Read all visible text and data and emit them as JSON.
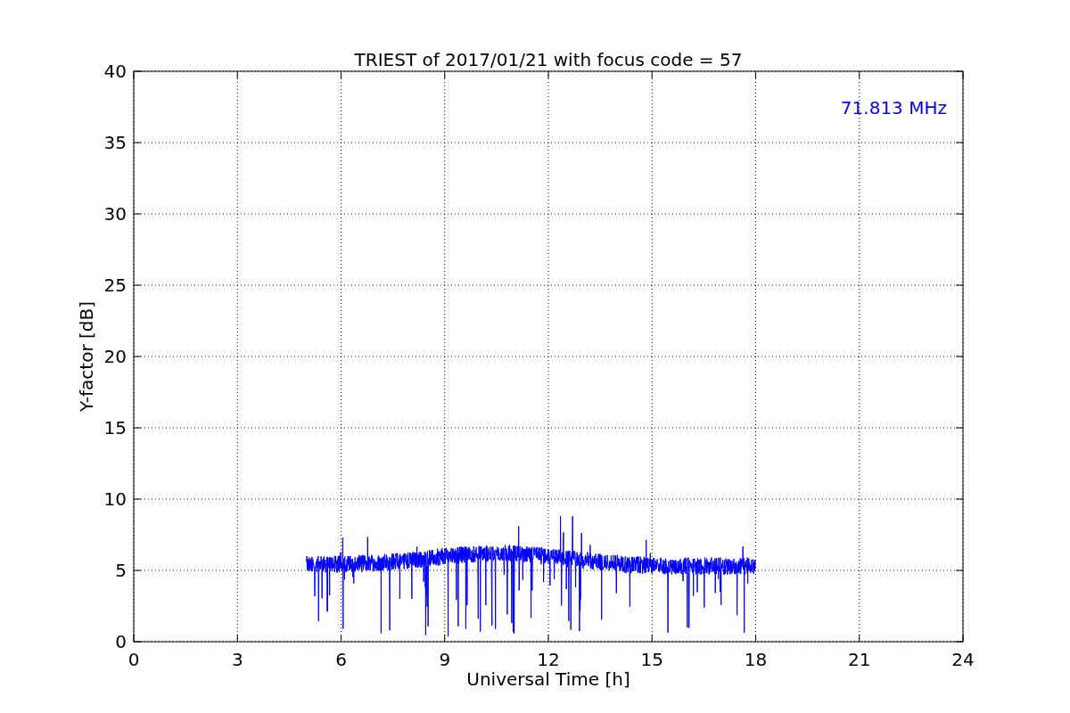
{
  "figure": {
    "chart_data": {
      "type": "line",
      "title": "TRIEST of 2017/01/21 with focus code = 57",
      "xlabel": "Universal Time [h]",
      "ylabel": "Y-factor [dB]",
      "xlim": [
        0,
        24
      ],
      "ylim": [
        0,
        40
      ],
      "xticks": [
        0,
        3,
        6,
        9,
        12,
        15,
        18,
        21,
        24
      ],
      "yticks": [
        0,
        5,
        10,
        15,
        20,
        25,
        30,
        35,
        40
      ],
      "grid": true,
      "annotations": [
        {
          "text": "71.813 MHz"
        }
      ]
    }
  }
}
